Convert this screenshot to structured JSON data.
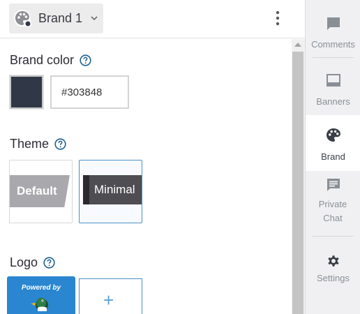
{
  "header": {
    "brand_label": "Brand 1",
    "icons": [
      "palette-icon",
      "chevron-down-icon",
      "more-vertical-icon"
    ]
  },
  "brand_color": {
    "title": "Brand color",
    "value": "#303848",
    "swatch_color": "#303848"
  },
  "theme": {
    "title": "Theme",
    "options": [
      "Default",
      "Minimal"
    ],
    "selected": "Minimal"
  },
  "logo": {
    "title": "Logo",
    "powered_by": "Powered by",
    "add_symbol": "+"
  },
  "sidebar": {
    "items": [
      {
        "label": "Comments",
        "icon": "comment-icon",
        "active": false
      },
      {
        "label": "Banners",
        "icon": "banner-icon",
        "active": false
      },
      {
        "label": "Brand",
        "icon": "palette-icon",
        "active": true
      },
      {
        "label": "Private Chat",
        "icon": "chat-icon",
        "active": false
      },
      {
        "label": "Settings",
        "icon": "gear-icon",
        "active": false
      }
    ]
  },
  "colors": {
    "accent": "#4a90c8",
    "help_icon": "#1d5f8f",
    "logo_bg": "#2a86d0"
  }
}
